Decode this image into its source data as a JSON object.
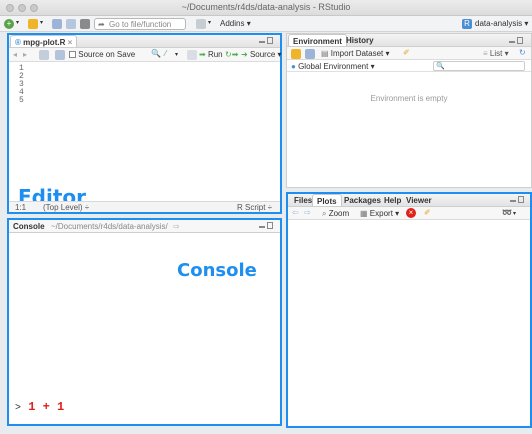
{
  "window": {
    "title": "~/Documents/r4ds/data-analysis - RStudio",
    "project": "data-analysis"
  },
  "toolbar": {
    "goto_placeholder": "Go to file/function",
    "addins": "Addins"
  },
  "editor": {
    "tab": "mpg-plot.R",
    "source_on_save": "Source on Save",
    "run": "Run",
    "source": "Source",
    "lines": [
      "1",
      "2",
      "3",
      "4",
      "5"
    ],
    "status_pos": "1:1",
    "status_scope": "(Top Level) ÷",
    "status_type": "R Script ÷",
    "overlay": "Editor"
  },
  "console": {
    "tab": "Console",
    "path": "~/Documents/r4ds/data-analysis/",
    "overlay": "Console",
    "prompt": ">",
    "command": "1 + 1"
  },
  "env": {
    "tabs": [
      "Environment",
      "History"
    ],
    "import": "Import Dataset",
    "list": "List",
    "scope": "Global Environment",
    "empty": "Environment is empty"
  },
  "files": {
    "tabs": [
      "Files",
      "Plots",
      "Packages",
      "Help",
      "Viewer"
    ],
    "zoom": "Zoom",
    "export": "Export"
  },
  "colors": {
    "accent": "#1e8ff0",
    "command": "#e0201a"
  }
}
